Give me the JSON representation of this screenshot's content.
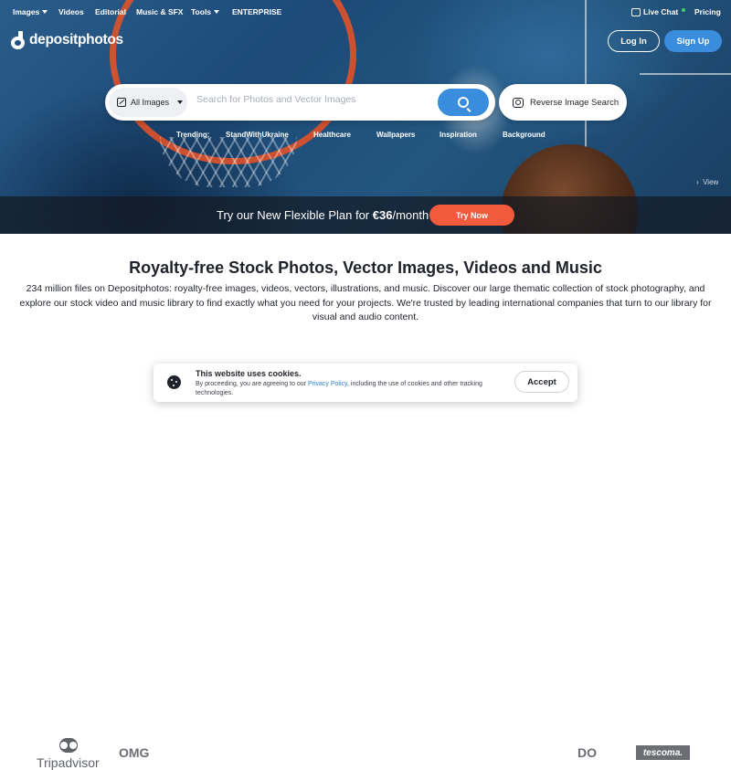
{
  "nav": {
    "items": [
      {
        "label": "Images",
        "dropdown": true
      },
      {
        "label": "Videos",
        "dropdown": false
      },
      {
        "label": "Editorial",
        "dropdown": false
      },
      {
        "label": "Music & SFX",
        "dropdown": false
      },
      {
        "label": "Tools",
        "dropdown": true
      },
      {
        "label": "ENTERPRISE",
        "dropdown": false
      }
    ],
    "live_chat": "Live Chat",
    "pricing": "Pricing"
  },
  "brand": {
    "name": "depositphotos"
  },
  "auth": {
    "login": "Log In",
    "signup": "Sign Up"
  },
  "search": {
    "type_selected": "All Images",
    "placeholder": "Search for Photos and Vector Images",
    "reverse_label": "Reverse Image Search"
  },
  "trending": {
    "label": "Trending:",
    "items": [
      "StandWithUkraine",
      "Healthcare",
      "Wallpapers",
      "Inspiration",
      "Background"
    ]
  },
  "hero": {
    "view_label": "View"
  },
  "promo": {
    "text_prefix": "Try our New Flexible Plan for ",
    "price": "€36",
    "text_suffix": "/month",
    "button": "Try Now"
  },
  "main": {
    "headline": "Royalty-free Stock Photos, Vector Images, Videos and Music",
    "intro": "234 million files on Depositphotos: royalty-free images, videos, vectors, illustrations, and music. Discover our large thematic collection of stock photography, and explore our stock video and music library to find exactly what you need for your projects. We're trusted by leading international companies that turn to our library for visual and audio content."
  },
  "clients": {
    "logos": [
      "Tripadvisor",
      "OMG",
      "DO",
      "tescoma."
    ]
  },
  "cookie": {
    "title": "This website uses cookies.",
    "body_prefix": "By proceeding, you are agreeing to our ",
    "link": "Privacy Policy",
    "body_suffix": ", including the use of cookies and other tracking technologies.",
    "accept": "Accept"
  },
  "colors": {
    "accent_blue": "#3a8cdc",
    "promo_orange": "#f15a3d",
    "live_dot": "#3fd16b"
  }
}
